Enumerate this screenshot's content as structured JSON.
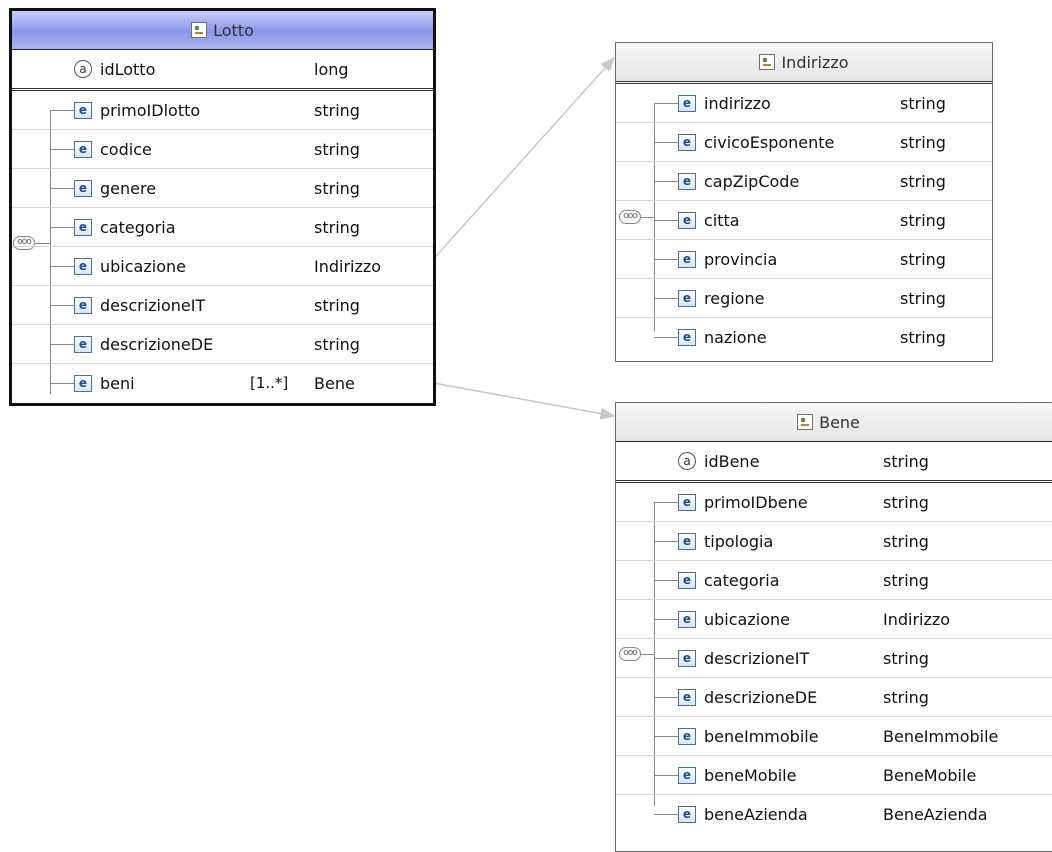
{
  "lotto": {
    "title": "Lotto",
    "attribute": {
      "name": "idLotto",
      "type": "long"
    },
    "elements": [
      {
        "name": "primoIDlotto",
        "type": "string",
        "mult": ""
      },
      {
        "name": "codice",
        "type": "string",
        "mult": ""
      },
      {
        "name": "genere",
        "type": "string",
        "mult": ""
      },
      {
        "name": "categoria",
        "type": "string",
        "mult": ""
      },
      {
        "name": "ubicazione",
        "type": "Indirizzo",
        "mult": ""
      },
      {
        "name": "descrizioneIT",
        "type": "string",
        "mult": ""
      },
      {
        "name": "descrizioneDE",
        "type": "string",
        "mult": ""
      },
      {
        "name": "beni",
        "type": "Bene",
        "mult": "[1..*]"
      }
    ]
  },
  "indirizzo": {
    "title": "Indirizzo",
    "elements": [
      {
        "name": "indirizzo",
        "type": "string"
      },
      {
        "name": "civicoEsponente",
        "type": "string"
      },
      {
        "name": "capZipCode",
        "type": "string"
      },
      {
        "name": "citta",
        "type": "string"
      },
      {
        "name": "provincia",
        "type": "string"
      },
      {
        "name": "regione",
        "type": "string"
      },
      {
        "name": "nazione",
        "type": "string"
      }
    ]
  },
  "bene": {
    "title": "Bene",
    "attribute": {
      "name": "idBene",
      "type": "string"
    },
    "elements": [
      {
        "name": "primoIDbene",
        "type": "string"
      },
      {
        "name": "tipologia",
        "type": "string"
      },
      {
        "name": "categoria",
        "type": "string"
      },
      {
        "name": "ubicazione",
        "type": "Indirizzo"
      },
      {
        "name": "descrizioneIT",
        "type": "string"
      },
      {
        "name": "descrizioneDE",
        "type": "string"
      },
      {
        "name": "beneImmobile",
        "type": "BeneImmobile"
      },
      {
        "name": "beneMobile",
        "type": "BeneMobile"
      },
      {
        "name": "beneAzienda",
        "type": "BeneAzienda"
      }
    ]
  },
  "icons": {
    "attribute": "a",
    "element": "e",
    "sequence": "ooo"
  }
}
